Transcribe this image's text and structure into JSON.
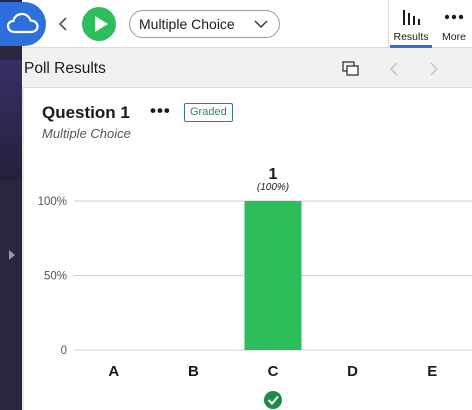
{
  "toolbar": {
    "question_type_selected": "Multiple Choice",
    "results_label": "Results",
    "more_label": "More"
  },
  "panel": {
    "title": "Poll Results"
  },
  "question": {
    "title": "Question 1",
    "menu_glyph": "•••",
    "badge": "Graded",
    "type": "Multiple Choice"
  },
  "colors": {
    "accent": "#2d6fdc",
    "play": "#2ebd5b",
    "bar": "#2ebd5b",
    "correct": "#1e8c45",
    "badge": "#2e8b57"
  },
  "chart_data": {
    "type": "bar",
    "categories": [
      "A",
      "B",
      "C",
      "D",
      "E"
    ],
    "values": [
      0,
      0,
      100,
      0,
      0
    ],
    "counts": [
      null,
      null,
      "1",
      null,
      null
    ],
    "percent_labels": [
      null,
      null,
      "(100%)",
      null,
      null
    ],
    "correct": "C",
    "y_ticks": [
      "0",
      "50%",
      "100%"
    ],
    "ylim": [
      0,
      100
    ],
    "grid": true
  }
}
